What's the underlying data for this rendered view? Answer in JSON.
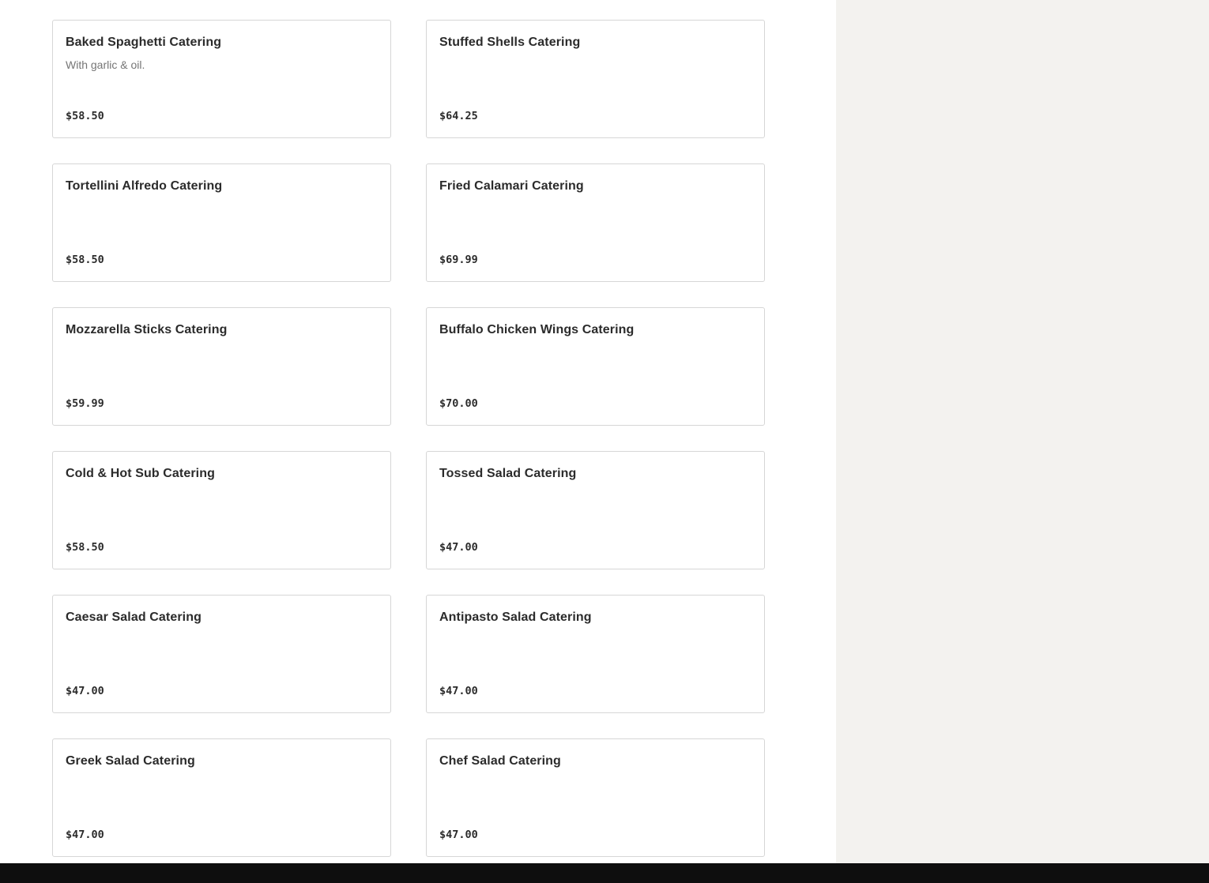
{
  "menu": {
    "items": [
      {
        "title": "Baked Spaghetti Catering",
        "description": "With garlic & oil.",
        "price": "$58.50"
      },
      {
        "title": "Stuffed Shells Catering",
        "description": "",
        "price": "$64.25"
      },
      {
        "title": "Tortellini Alfredo Catering",
        "description": "",
        "price": "$58.50"
      },
      {
        "title": "Fried Calamari Catering",
        "description": "",
        "price": "$69.99"
      },
      {
        "title": "Mozzarella Sticks Catering",
        "description": "",
        "price": "$59.99"
      },
      {
        "title": "Buffalo Chicken Wings Catering",
        "description": "",
        "price": "$70.00"
      },
      {
        "title": "Cold & Hot Sub Catering",
        "description": "",
        "price": "$58.50"
      },
      {
        "title": "Tossed Salad Catering",
        "description": "",
        "price": "$47.00"
      },
      {
        "title": "Caesar Salad Catering",
        "description": "",
        "price": "$47.00"
      },
      {
        "title": "Antipasto Salad Catering",
        "description": "",
        "price": "$47.00"
      },
      {
        "title": "Greek Salad Catering",
        "description": "",
        "price": "$47.00"
      },
      {
        "title": "Chef Salad Catering",
        "description": "",
        "price": "$47.00"
      }
    ]
  },
  "colors": {
    "side_panel_bg": "#f3f2ef",
    "footer_bg": "#0e0e0e",
    "card_border": "#d6d6d6",
    "title_text": "#2b2b2b",
    "description_text": "#757575"
  }
}
